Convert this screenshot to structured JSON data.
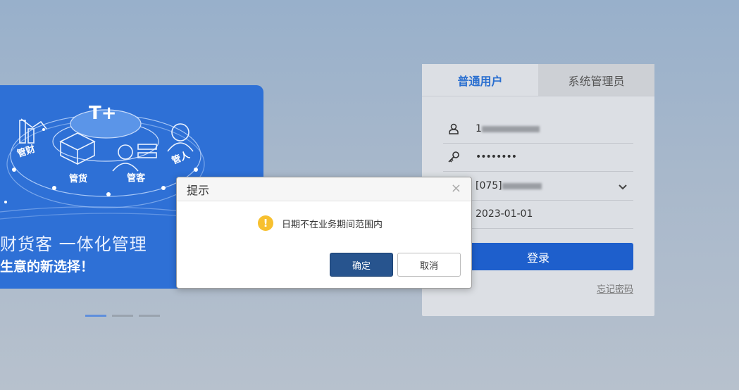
{
  "banner": {
    "illustration_labels": [
      "管财",
      "管货",
      "管客",
      "管人"
    ],
    "badge": "T+",
    "line1": "财货客 一体化管理",
    "line2": "生意的新选择！",
    "slides": 3,
    "active_slide": 0
  },
  "login": {
    "tabs": [
      {
        "label": "普通用户",
        "active": true
      },
      {
        "label": "系统管理员",
        "active": false
      }
    ],
    "username_visible": "1",
    "password": "••••••••",
    "account_prefix": "[075]",
    "date": "2023-01-01",
    "login_label": "登录",
    "forgot_label": "忘记密码",
    "icons": [
      "user-icon",
      "key-icon",
      "chevron-down-icon"
    ]
  },
  "dialog": {
    "title": "提示",
    "message": "日期不在业务期间范围内",
    "ok_label": "确定",
    "cancel_label": "取消",
    "warn_glyph": "!",
    "close_glyph": "×"
  },
  "colors": {
    "accent": "#1e5fcc",
    "tab_active": "#2a6fd0",
    "banner": "#2e70d6",
    "ok_button": "#27548e",
    "warning": "#f7c02f"
  }
}
